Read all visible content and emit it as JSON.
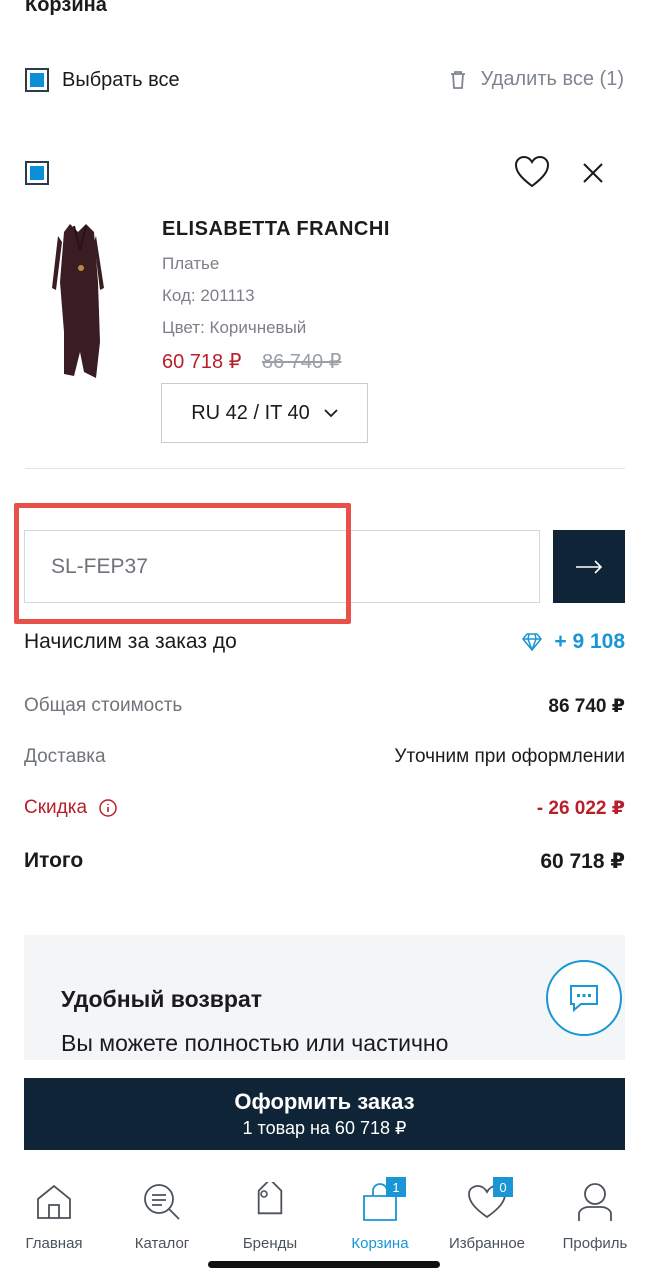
{
  "page": {
    "title": "Корзина"
  },
  "toolbar": {
    "select_all_label": "Выбрать все",
    "delete_all_label": "Удалить все (1)"
  },
  "product": {
    "brand": "ELISABETTA FRANCHI",
    "type": "Платье",
    "code": "Код: 201113",
    "color": "Цвет: Коричневый",
    "price_new": "60 718 ₽",
    "price_old": "86 740 ₽",
    "size": "RU 42 / IT 40",
    "selected": true
  },
  "promo": {
    "value": "SL-FEP37"
  },
  "summary": {
    "bonus_label": "Начислим за заказ до",
    "bonus_value": "+ 9 108",
    "total_label": "Общая стоимость",
    "total_value": "86 740 ₽",
    "delivery_label": "Доставка",
    "delivery_value": "Уточним при оформлении",
    "discount_label": "Скидка",
    "discount_value": "- 26 022 ₽",
    "grand_label": "Итого",
    "grand_value": "60 718 ₽"
  },
  "return_card": {
    "title": "Удобный возврат",
    "text": "Вы можете полностью или частично"
  },
  "checkout": {
    "title": "Оформить заказ",
    "subtitle": "1 товар на 60 718 ₽"
  },
  "nav": {
    "items": [
      {
        "label": "Главная",
        "icon": "home-icon"
      },
      {
        "label": "Каталог",
        "icon": "catalog-search-icon"
      },
      {
        "label": "Бренды",
        "icon": "tag-icon"
      },
      {
        "label": "Корзина",
        "icon": "bag-icon",
        "badge": "1",
        "active": true
      },
      {
        "label": "Избранное",
        "icon": "heart-icon",
        "badge": "0"
      },
      {
        "label": "Профиль",
        "icon": "user-icon"
      }
    ]
  },
  "colors": {
    "accent": "#1a96d6",
    "dark": "#0f2436",
    "sale": "#b81f2b",
    "highlight": "#e8504a"
  }
}
